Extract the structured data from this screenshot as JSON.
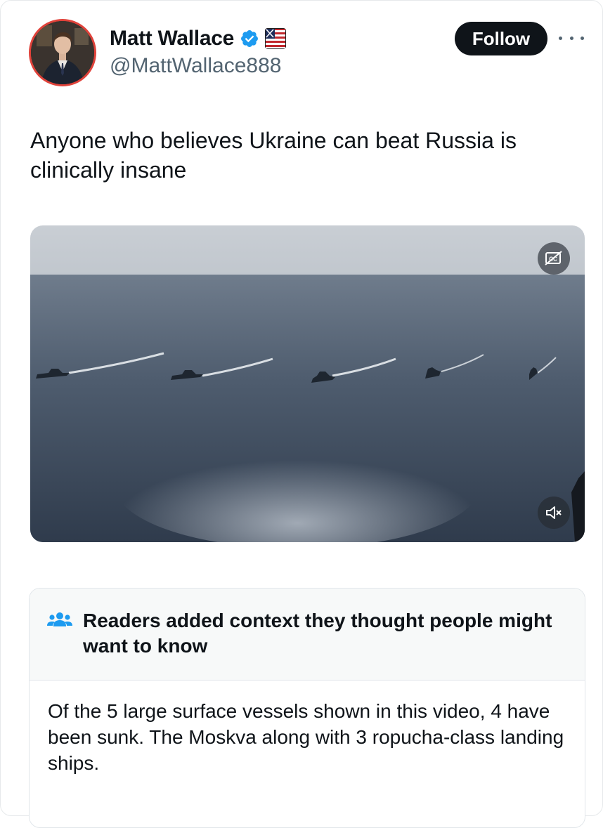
{
  "author": {
    "name": "Matt Wallace",
    "handle": "@MattWallace888",
    "verified_icon": "verified-badge-icon",
    "flag_icon": "us-flag-icon",
    "avatar": "profile-avatar"
  },
  "actions": {
    "follow_label": "Follow",
    "more_icon": "more-options-icon"
  },
  "tweet": {
    "text": "Anyone who believes Ukraine can beat Russia is clinically insane"
  },
  "media": {
    "type": "video",
    "description_icon": "video-thumbnail",
    "cc_icon": "closed-captions-icon",
    "mute_icon": "muted-speaker-icon"
  },
  "community_note": {
    "icon": "people-icon",
    "title": "Readers added context they thought people might want to know",
    "body": "Of the 5 large surface vessels shown in this video, 4 have been sunk. The Moskva along with 3 ropucha-class landing ships."
  },
  "colors": {
    "follow_bg": "#0f1419",
    "handle": "#536471",
    "verified": "#1d9bf0",
    "note_header_bg": "#f7f9f9",
    "avatar_ring": "#e0423a"
  }
}
